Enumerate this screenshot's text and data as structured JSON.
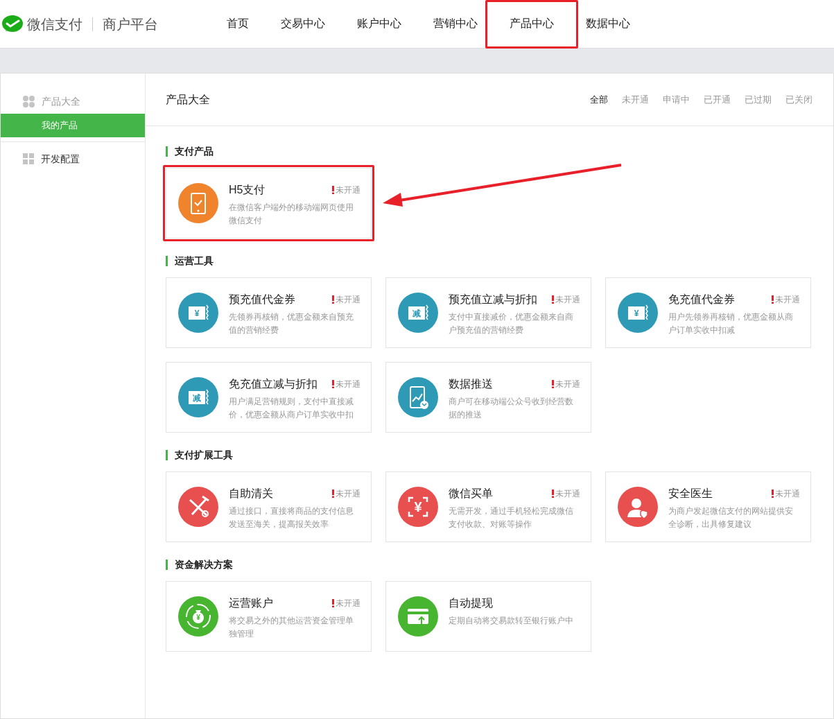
{
  "brand": {
    "name": "微信支付",
    "subtitle": "商户平台"
  },
  "nav": [
    {
      "label": "首页",
      "selected": false,
      "annotated": false
    },
    {
      "label": "交易中心",
      "selected": false,
      "annotated": false
    },
    {
      "label": "账户中心",
      "selected": false,
      "annotated": false
    },
    {
      "label": "营销中心",
      "selected": false,
      "annotated": false
    },
    {
      "label": "产品中心",
      "selected": true,
      "annotated": true
    },
    {
      "label": "数据中心",
      "selected": false,
      "annotated": false
    }
  ],
  "sidebar": {
    "items": [
      {
        "label": "产品大全",
        "kind": "dots",
        "selected": false,
        "children": [
          {
            "label": "我的产品",
            "selected": true
          }
        ]
      },
      {
        "label": "开发配置",
        "kind": "grid",
        "selected": false
      }
    ]
  },
  "page_title": "产品大全",
  "filters": [
    {
      "label": "全部",
      "selected": true
    },
    {
      "label": "未开通",
      "selected": false
    },
    {
      "label": "申请中",
      "selected": false
    },
    {
      "label": "已开通",
      "selected": false
    },
    {
      "label": "已过期",
      "selected": false
    },
    {
      "label": "已关闭",
      "selected": false
    }
  ],
  "sections": [
    {
      "title": "支付产品",
      "cards": [
        {
          "title": "H5支付",
          "status": "未开通",
          "description": "在微信客户端外的移动端网页使用微信支付",
          "kind": "phone-check",
          "color": "#f0842c",
          "annotated": true
        }
      ]
    },
    {
      "title": "运营工具",
      "cards": [
        {
          "title": "预充值代金券",
          "status": "未开通",
          "description": "先领券再核销，优惠金额来自预充值的营销经费",
          "kind": "voucher",
          "icon_label": "¥",
          "color": "#2e9ab6",
          "annotated": false
        },
        {
          "title": "预充值立减与折扣",
          "status": "未开通",
          "description": "支付中直接减价，优惠金额来自商户预充值的营销经费",
          "kind": "voucher",
          "icon_label": "减",
          "color": "#2e9ab6",
          "annotated": false
        },
        {
          "title": "免充值代金券",
          "status": "未开通",
          "description": "用户先领券再核销，优惠金额从商户订单实收中扣减",
          "kind": "voucher",
          "icon_label": "¥",
          "color": "#2e9ab6",
          "annotated": false
        },
        {
          "title": "免充值立减与折扣",
          "status": "未开通",
          "description": "用户满足营销规则，支付中直接减价，优惠金额从商户订单实收中扣",
          "kind": "voucher",
          "icon_label": "减",
          "color": "#2e9ab6",
          "annotated": false
        },
        {
          "title": "数据推送",
          "status": "未开通",
          "description": "商户可在移动端公众号收到经营数据的推送",
          "kind": "phone-chart",
          "color": "#2e9ab6",
          "annotated": false
        }
      ]
    },
    {
      "title": "支付扩展工具",
      "cards": [
        {
          "title": "自助清关",
          "status": "未开通",
          "description": "通过接口，直接将商品的支付信息发送至海关，提高报关效率",
          "kind": "tools",
          "color": "#e84f4f",
          "annotated": false
        },
        {
          "title": "微信买单",
          "status": "未开通",
          "description": "无需开发，通过手机轻松完成微信支付收款、对账等操作",
          "kind": "scan",
          "icon_label": "¥",
          "color": "#e84f4f",
          "annotated": false
        },
        {
          "title": "安全医生",
          "status": "未开通",
          "description": "为商户发起微信支付的网站提供安全诊断，出具修复建议",
          "kind": "doctor",
          "color": "#e84f4f",
          "annotated": false
        }
      ]
    },
    {
      "title": "资金解决方案",
      "cards": [
        {
          "title": "运营账户",
          "status": "未开通",
          "description": "将交易之外的其他运营资金管理单独管理",
          "kind": "money-bag",
          "icon_label": "¥",
          "color": "#47b52f",
          "annotated": false
        },
        {
          "title": "自动提现",
          "description": "定期自动将交易款转至银行账户中",
          "kind": "card",
          "color": "#47b52f",
          "annotated": false
        }
      ]
    }
  ],
  "annotation_arrow": true
}
